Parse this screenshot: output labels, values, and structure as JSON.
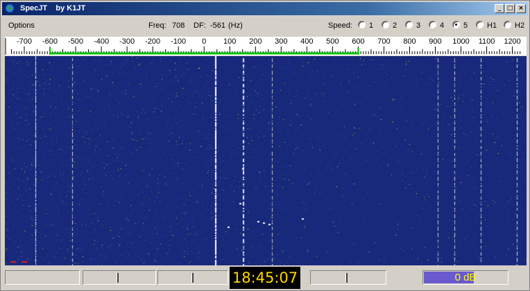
{
  "window": {
    "app_name": "SpecJT",
    "author": "by K1JT",
    "minimize_glyph": "_",
    "maximize_glyph": "□",
    "close_glyph": "×"
  },
  "toolbar": {
    "menu_options": "Options",
    "freq_label": "Freq:",
    "freq_value": "708",
    "df_label": "DF:",
    "df_value": "-561",
    "df_unit": "(Hz)",
    "speed_label": "Speed:",
    "speed_options": [
      {
        "label": "1",
        "selected": false
      },
      {
        "label": "2",
        "selected": false
      },
      {
        "label": "3",
        "selected": false
      },
      {
        "label": "4",
        "selected": false
      },
      {
        "label": "5",
        "selected": true
      },
      {
        "label": "H1",
        "selected": false
      },
      {
        "label": "H2",
        "selected": false
      }
    ]
  },
  "scale": {
    "labels": [
      "-700",
      "-600",
      "-500",
      "-400",
      "-300",
      "-200",
      "-100",
      "0",
      "100",
      "200",
      "300",
      "400",
      "500",
      "600",
      "700",
      "800",
      "900",
      "1000",
      "1100",
      "1200"
    ],
    "passband_hz": [
      -600,
      600
    ],
    "passband_color": "#00c000"
  },
  "waterfall": {
    "background_color": "#18287a",
    "noise_colors": [
      "#2a3f9a",
      "#3c5cb0",
      "#2f8f8f",
      "#8fbf3f",
      "#dfe84a"
    ]
  },
  "status": {
    "time": "18:45:07",
    "level_text": "0 dB",
    "level_fraction": 0.6
  }
}
